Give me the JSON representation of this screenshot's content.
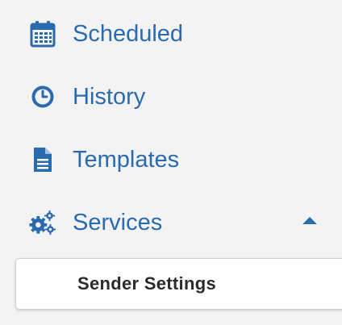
{
  "colors": {
    "link": "#2a6bb0",
    "submenu_text": "#2b2b2b",
    "background": "#f3f3f3",
    "submenu_background": "#ffffff"
  },
  "nav": {
    "items": [
      {
        "label": "Scheduled",
        "icon": "calendar-icon"
      },
      {
        "label": "History",
        "icon": "clock-icon"
      },
      {
        "label": "Templates",
        "icon": "document-icon"
      },
      {
        "label": "Services",
        "icon": "gears-icon",
        "expanded": true
      }
    ],
    "services_submenu": [
      {
        "label": "Sender Settings"
      }
    ]
  }
}
